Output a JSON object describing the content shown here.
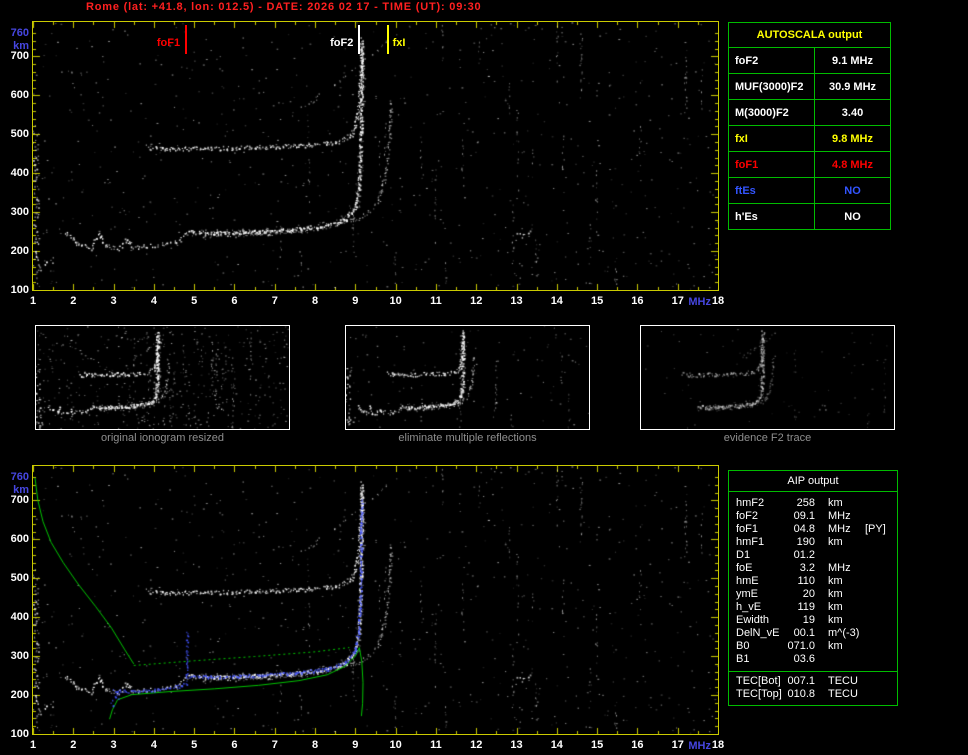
{
  "title": "Rome (lat: +41.8, lon: 012.5) - DATE: 2026 02 17 - TIME (UT): 09:30",
  "colors": {
    "background": "#000000",
    "title_red": "#ff2020",
    "plot_border_yellow": "#caca00",
    "axis_blue": "#4646e0",
    "axis_white": "#ffffff",
    "table_border_green": "#00bc00",
    "caption_gray": "#8f8f8f",
    "trace_white": "#ffffff",
    "profile_green": "#00c400",
    "restored_trace_blue": "#4455ff",
    "marker_red": "#ff0000",
    "marker_yellow": "#ffff00"
  },
  "ionogram": {
    "x_axis": {
      "unit": "MHz",
      "min": 1,
      "max": 18,
      "ticks": [
        "1",
        "2",
        "3",
        "4",
        "5",
        "6",
        "7",
        "8",
        "9",
        "10",
        "11",
        "12",
        "13",
        "14",
        "15",
        "16",
        "17",
        "18"
      ]
    },
    "y_axis": {
      "unit": "km",
      "min": 100,
      "max": 760,
      "ticks": [
        "760",
        "700",
        "600",
        "500",
        "400",
        "300",
        "200",
        "100"
      ]
    },
    "markers": [
      {
        "label": "foF1",
        "freq_mhz": 4.8,
        "color": "#ff0000",
        "text_side": "left"
      },
      {
        "label": "foF2",
        "freq_mhz": 9.1,
        "color": "#ffffff",
        "text_side": "left"
      },
      {
        "label": "fxI",
        "freq_mhz": 9.8,
        "color": "#ffff00",
        "text_side": "right"
      }
    ]
  },
  "autoscala_table": {
    "title": "AUTOSCALA output",
    "rows": [
      {
        "param": "foF2",
        "value": "9.1 MHz",
        "color": "#ffffff"
      },
      {
        "param": "MUF(3000)F2",
        "value": "30.9 MHz",
        "color": "#ffffff"
      },
      {
        "param": "M(3000)F2",
        "value": "3.40",
        "color": "#ffffff"
      },
      {
        "param": "fxI",
        "value": "9.8 MHz",
        "color": "#ffff00"
      },
      {
        "param": "foF1",
        "value": "4.8 MHz",
        "color": "#ff0000"
      },
      {
        "param": "ftEs",
        "value": "NO",
        "color": "#3355ff"
      },
      {
        "param": "h'Es",
        "value": "NO",
        "color": "#ffffff"
      }
    ]
  },
  "thumbnails": [
    {
      "caption": "original ionogram resized"
    },
    {
      "caption": "eliminate multiple reflections"
    },
    {
      "caption": "evidence F2 trace"
    }
  ],
  "aip_table": {
    "title": "AIP output",
    "rows": [
      {
        "param": "hmF2",
        "value": "258",
        "unit": "km",
        "extra": ""
      },
      {
        "param": "foF2",
        "value": "09.1",
        "unit": "MHz",
        "extra": ""
      },
      {
        "param": "foF1",
        "value": "04.8",
        "unit": "MHz",
        "extra": "[PY]"
      },
      {
        "param": "hmF1",
        "value": "190",
        "unit": "km",
        "extra": ""
      },
      {
        "param": "D1",
        "value": "01.2",
        "unit": "",
        "extra": ""
      },
      {
        "param": "foE",
        "value": "3.2",
        "unit": "MHz",
        "extra": ""
      },
      {
        "param": "hmE",
        "value": "110",
        "unit": "km",
        "extra": ""
      },
      {
        "param": "ymE",
        "value": "20",
        "unit": "km",
        "extra": ""
      },
      {
        "param": "h_vE",
        "value": "119",
        "unit": "km",
        "extra": ""
      },
      {
        "param": "Ewidth",
        "value": "19",
        "unit": "km",
        "extra": ""
      },
      {
        "param": "DelN_vE",
        "value": "00.1",
        "unit": "m^(-3)",
        "extra": ""
      },
      {
        "param": "B0",
        "value": "071.0",
        "unit": "km",
        "extra": ""
      },
      {
        "param": "B1",
        "value": "03.6",
        "unit": "",
        "extra": ""
      }
    ],
    "tec_rows": [
      {
        "param": "TEC[Bot]",
        "value": "007.1",
        "unit": "TECU"
      },
      {
        "param": "TEC[Top]",
        "value": "010.8",
        "unit": "TECU"
      }
    ]
  }
}
